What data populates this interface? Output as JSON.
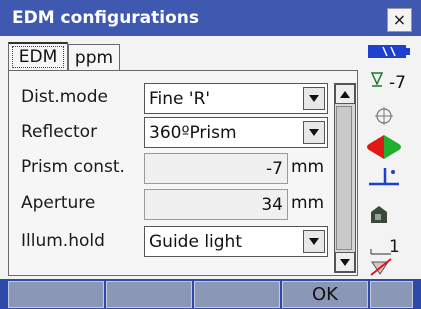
{
  "window": {
    "title": "EDM configurations",
    "close_label": "×"
  },
  "tabs": [
    {
      "label": "EDM"
    },
    {
      "label": "ppm"
    }
  ],
  "fields": {
    "dist_mode": {
      "label": "Dist.mode",
      "value": "Fine 'R'"
    },
    "reflector": {
      "label": "Reflector",
      "value": "360ºPrism"
    },
    "prism_const": {
      "label": "Prism const.",
      "value": "-7",
      "unit": "mm"
    },
    "aperture": {
      "label": "Aperture",
      "value": "34",
      "unit": "mm"
    },
    "illum_hold": {
      "label": "Illum.hold",
      "value": "Guide light"
    }
  },
  "status": {
    "prism_const_value": "-7",
    "laser_count": "1"
  },
  "softkeys": [
    {
      "label": ""
    },
    {
      "label": ""
    },
    {
      "label": ""
    },
    {
      "label": "OK"
    },
    {
      "label": ""
    }
  ],
  "colors": {
    "title_bar": "#3f59b0",
    "softkey_bar": "#2d4aa8",
    "accent_blue": "#1e3fd0",
    "status_red": "#e01818",
    "status_green": "#20b030"
  }
}
